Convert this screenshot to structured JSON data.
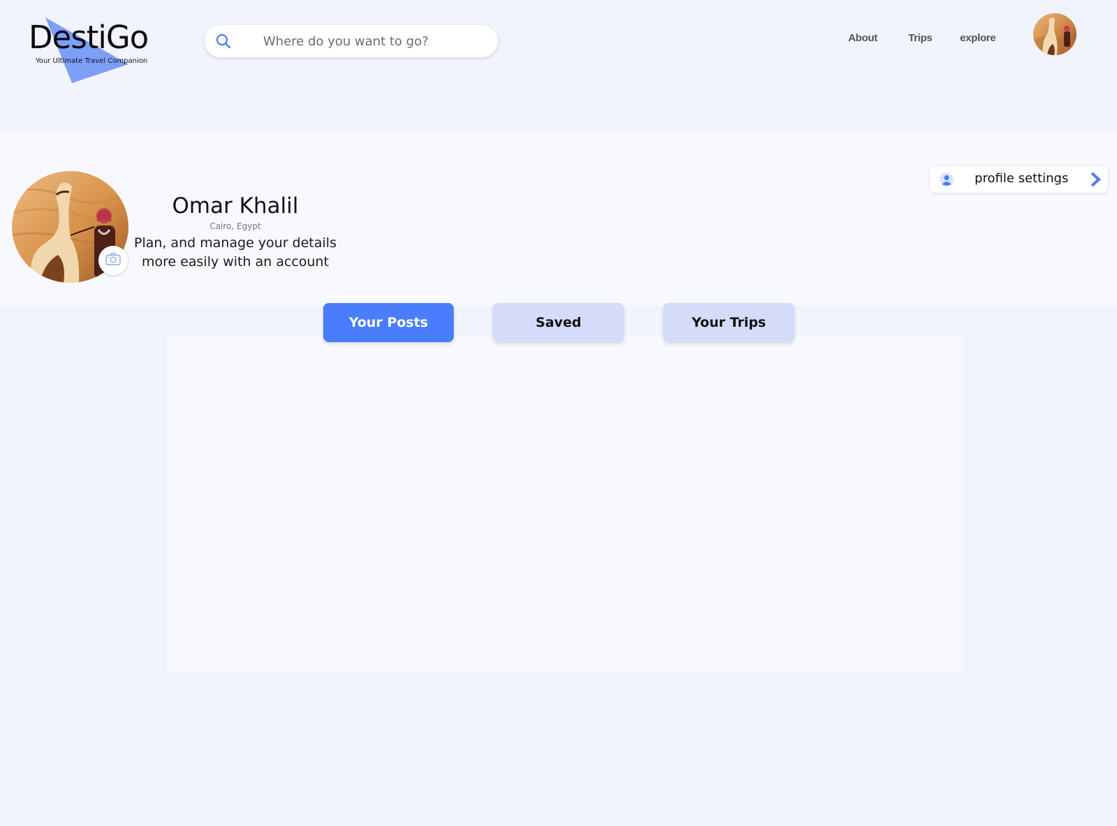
{
  "brand": {
    "name": "DestiGo",
    "tagline": "Your Ultimate Travel Companion",
    "accent_color": "#4a7dfb"
  },
  "search": {
    "placeholder": "Where do you want to go?",
    "value": ""
  },
  "nav": {
    "items": [
      {
        "label": "About"
      },
      {
        "label": "Trips"
      },
      {
        "label": "explore"
      }
    ]
  },
  "profile": {
    "name": "Omar Khalil",
    "location": "Cairo, Egypt",
    "description_line1": "Plan, and manage your details",
    "description_line2": "more easily with an account",
    "settings_label": "profile settings"
  },
  "tabs": [
    {
      "label": "Your Posts",
      "active": true
    },
    {
      "label": "Saved",
      "active": false
    },
    {
      "label": "Your Trips",
      "active": false
    }
  ],
  "icons": {
    "search": "search-icon",
    "user": "user-icon",
    "chevron": "chevron-right-icon",
    "camera": "camera-icon"
  }
}
